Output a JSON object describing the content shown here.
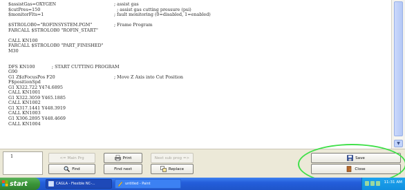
{
  "editor": {
    "lines": [
      {
        "cmd": "$assistGas=OXYGEN",
        "cmt": "; assist gas"
      },
      {
        "cmd": "$cutPres=150",
        "cmt": "  ; assist gas cutting pressure (psi)"
      },
      {
        "cmd": "$monitorFlts=1",
        "cmt": "; fault monitoring (0=disabled, 1=enabled)"
      },
      {
        "cmd": "",
        "cmt": ""
      },
      {
        "cmd": "$STROLOB0=\"ROFINSYSTEM.PGM\"",
        "cmt": "; Frame Program"
      },
      {
        "cmd": "FARCALL $STROLOB0 \"ROFIN_START\"",
        "cmt": ""
      },
      {
        "cmd": "",
        "cmt": ""
      },
      {
        "cmd": "CALL KN100",
        "cmt": ""
      },
      {
        "cmd": "FARCALL $STROLOB0 \"PART_FINISHED\"",
        "cmt": ""
      },
      {
        "cmd": "M30",
        "cmt": ""
      },
      {
        "cmd": "",
        "cmt": ""
      },
      {
        "cmd": "",
        "cmt": ""
      },
      {
        "cmd": "DFS KN100            ; START CUTTING PROGRAM",
        "cmt": ""
      },
      {
        "cmd": "G90",
        "cmt": ""
      },
      {
        "cmd": "G1 Z$zFocusPos F20",
        "cmt": "; Move Z Axis into Cut Position"
      },
      {
        "cmd": "F$positionSpd",
        "cmt": ""
      },
      {
        "cmd": "G1 X322.722 Y474.6895",
        "cmt": ""
      },
      {
        "cmd": "CALL KN1001",
        "cmt": ""
      },
      {
        "cmd": "G1 X322.3059 Y465.1885",
        "cmt": ""
      },
      {
        "cmd": "CALL KN1002",
        "cmt": ""
      },
      {
        "cmd": "G1 X317.1441 Y448.3919",
        "cmt": ""
      },
      {
        "cmd": "CALL KN1003",
        "cmt": ""
      },
      {
        "cmd": "G1 X306.2895 Y448.4669",
        "cmt": ""
      },
      {
        "cmd": "CALL KN1004",
        "cmt": ""
      }
    ]
  },
  "panel": {
    "line_number": "1",
    "buttons": {
      "main_prg": "<= Main Prg",
      "print": "Print",
      "next_sub_prog": "Next sub prog =>",
      "find": "Find",
      "find_next": "Find next",
      "replace": "Replace",
      "save": "Save",
      "close": "Close"
    }
  },
  "taskbar": {
    "start_label": "start",
    "items": [
      {
        "label": "CAGLA - Flexible NC-..."
      },
      {
        "label": "untitled - Paint"
      }
    ],
    "clock": "11:31 AM"
  },
  "colors": {
    "highlight": "#41e04a",
    "taskbar": "#245edb",
    "start": "#3b953a"
  }
}
